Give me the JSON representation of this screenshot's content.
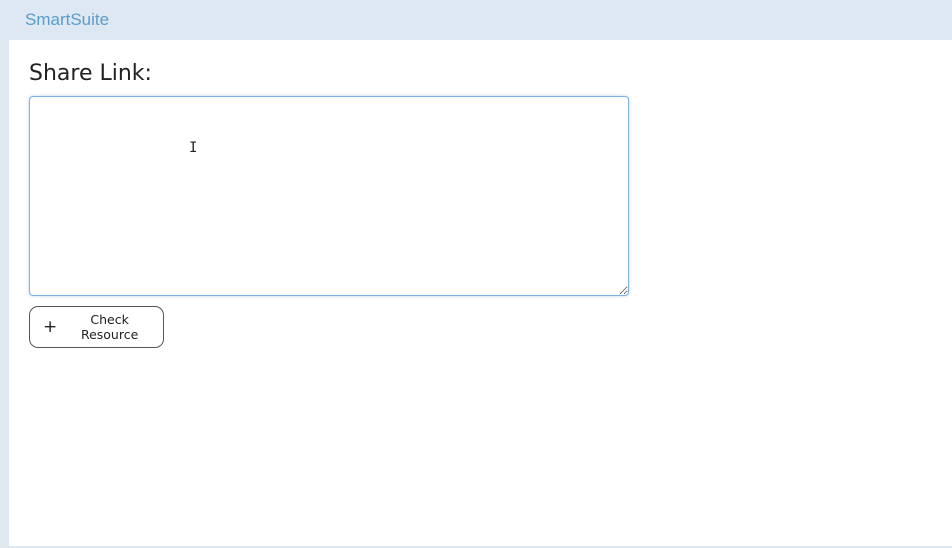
{
  "app": {
    "brand": "SmartSuite"
  },
  "form": {
    "share_label": "Share Link:",
    "share_value": "",
    "check_button_label": "Check Resource"
  },
  "icons": {
    "plus": "plus-icon",
    "cursor": "text-cursor-icon"
  },
  "colors": {
    "brand": "#5a9ccc",
    "focus_border": "#7fb2e0"
  }
}
